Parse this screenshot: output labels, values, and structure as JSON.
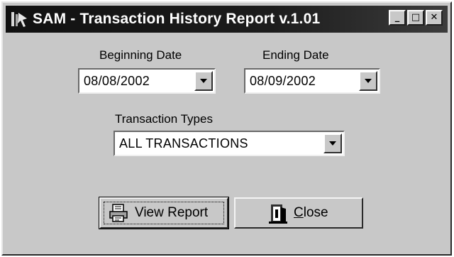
{
  "window": {
    "title": "SAM - Transaction History Report v.1.01",
    "minimize": "_",
    "maximize": "□",
    "close": "✕"
  },
  "begin_date": {
    "label": "Beginning Date",
    "value": "08/08/2002"
  },
  "end_date": {
    "label": "Ending Date",
    "value": "08/09/2002"
  },
  "transaction_types": {
    "label": "Transaction Types",
    "value": "ALL TRANSACTIONS"
  },
  "buttons": {
    "view_report": {
      "label": "View Report",
      "icon": "report-printer-icon"
    },
    "close": {
      "mnemonic": "C",
      "rest": "lose",
      "icon": "door-exit-icon"
    }
  },
  "colors": {
    "face": "#c8c8c8",
    "titlebar": "#111111"
  }
}
